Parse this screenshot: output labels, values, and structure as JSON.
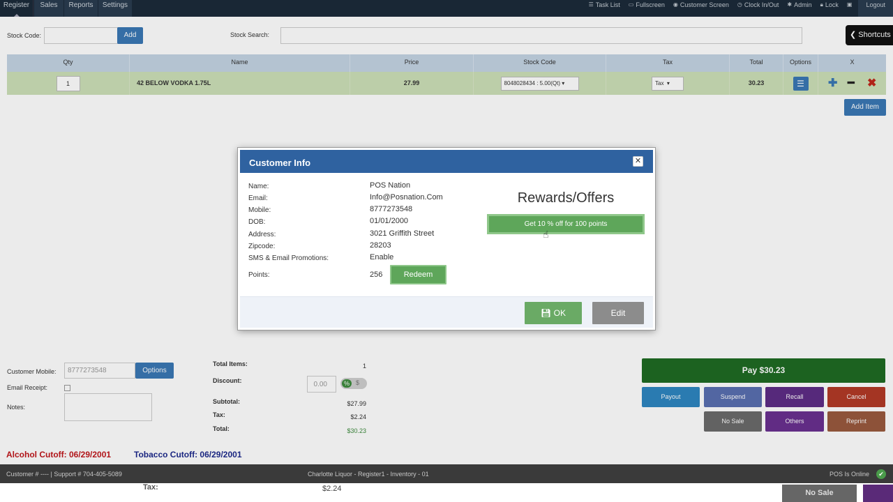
{
  "nav": {
    "tabs": [
      "Register",
      "Sales",
      "Reports",
      "Settings"
    ],
    "right_links": [
      "Task List",
      "Fullscreen",
      "Customer Screen",
      "Clock In/Out",
      "Admin",
      "Lock",
      "",
      "Logout"
    ]
  },
  "stock": {
    "code_label": "Stock Code:",
    "add_label": "Add",
    "search_label": "Stock Search:",
    "shortcuts_label": "Shortcuts"
  },
  "table": {
    "headers": [
      "Qty",
      "Name",
      "Price",
      "Stock Code",
      "Tax",
      "Total",
      "Options",
      "X"
    ],
    "row": {
      "qty": "1",
      "name": "42 BELOW VODKA 1.75L",
      "price": "27.99",
      "stock_code": "8048028434 : 5.00(Qt)",
      "tax": "Tax",
      "total": "30.23"
    },
    "add_item_label": "Add Item"
  },
  "customer": {
    "mobile_label": "Customer Mobile:",
    "mobile_value": "8777273548",
    "options_label": "Options",
    "email_receipt_label": "Email Receipt:",
    "notes_label": "Notes:"
  },
  "totals": {
    "total_items_label": "Total Items:",
    "total_items": "1",
    "discount_label": "Discount:",
    "discount_value": "0.00",
    "pct_symbol": "%",
    "dollar_symbol": "$",
    "subtotal_label": "Subtotal:",
    "subtotal": "$27.99",
    "tax_label": "Tax:",
    "tax": "$2.24",
    "total_label": "Total:",
    "total": "$30.23"
  },
  "actions": {
    "pay": "Pay $30.23",
    "payout": "Payout",
    "suspend": "Suspend",
    "recall": "Recall",
    "cancel": "Cancel",
    "no_sale": "No Sale",
    "others": "Others",
    "reprint": "Reprint"
  },
  "cutoffs": {
    "alcohol": "Alcohol Cutoff: 06/29/2001",
    "tobacco": "Tobacco Cutoff: 06/29/2001"
  },
  "footer": {
    "left": "Customer # ---- | Support # 704-405-5089",
    "center": "Charlotte Liquor - Register1 - Inventory - 01",
    "right": "POS Is Online"
  },
  "under": {
    "tax_label": "Tax:",
    "tax_value": "$2.24",
    "no_sale": "No Sale"
  },
  "modal": {
    "title": "Customer Info",
    "fields": [
      {
        "label": "Name:",
        "value": "POS Nation"
      },
      {
        "label": "Email:",
        "value": "Info@Posnation.Com"
      },
      {
        "label": "Mobile:",
        "value": "8777273548"
      },
      {
        "label": "DOB:",
        "value": "01/01/2000"
      },
      {
        "label": "Address:",
        "value": "3021 Griffith Street"
      },
      {
        "label": "Zipcode:",
        "value": "28203"
      },
      {
        "label": "SMS & Email Promotions:",
        "value": "Enable"
      }
    ],
    "points_label": "Points:",
    "points_value": "256",
    "redeem_label": "Redeem",
    "rewards_title": "Rewards/Offers",
    "offer_label": "Get 10 % off for 100 points",
    "ok_label": "OK",
    "edit_label": "Edit"
  },
  "colors": {
    "nav_bg": "#1c2b3a",
    "primary_blue": "#3a78b5",
    "modal_header": "#2f62a0",
    "row_green": "#cde0b8",
    "pay_green": "#1f6b23",
    "alcohol_red": "#c0161b",
    "tobacco_blue": "#1d2a8c"
  }
}
